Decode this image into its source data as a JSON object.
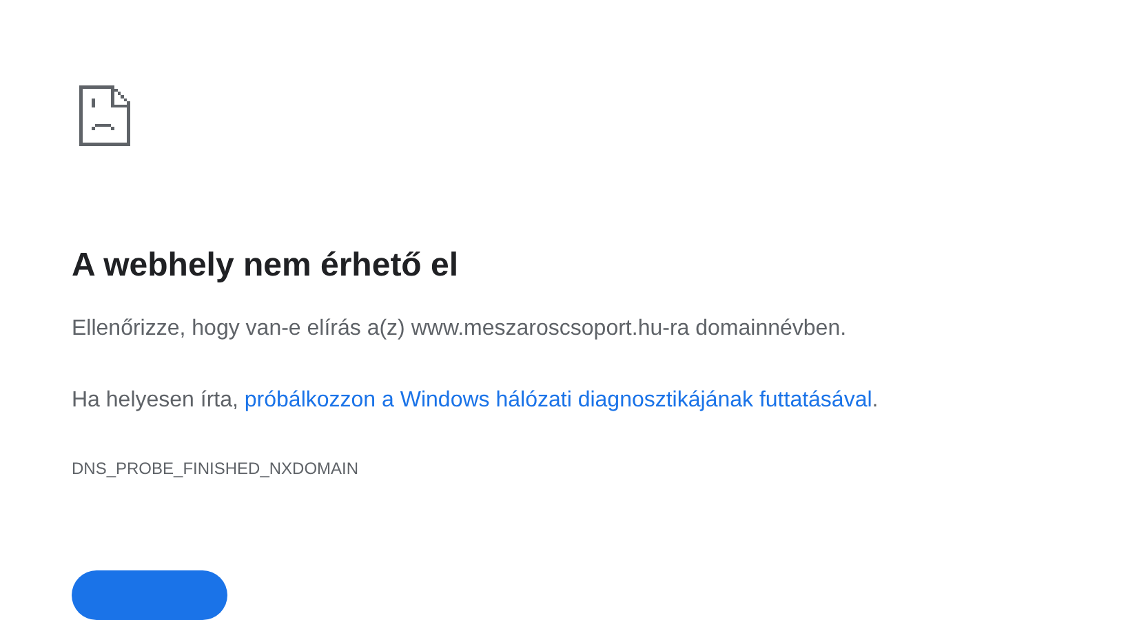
{
  "title": "A webhely nem érhető el",
  "message": "Ellenőrizze, hogy van-e elírás a(z) www.meszaroscsoport.hu-ra domainnévben.",
  "suggestion": {
    "prefix": "Ha helyesen írta, ",
    "link": "próbálkozzon a Windows hálózati diagnosztikájának futtatásával",
    "suffix": "."
  },
  "error_code": "DNS_PROBE_FINISHED_NXDOMAIN"
}
